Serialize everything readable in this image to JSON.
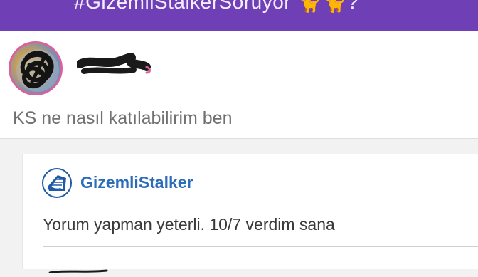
{
  "header": {
    "title": "#GizemliStalkerSoruyor 🐈🐈?",
    "background": "#6f3fb5"
  },
  "post": {
    "avatar_icon": "user-avatar-scribbled",
    "username_icon": "redacted-username",
    "text": "KS ne nasıl katılabilirim ben"
  },
  "reply": {
    "avatar_icon": "gizemlistalker-avatar",
    "username": "GizemliStalker",
    "username_color": "#2c6cb8",
    "text": "Yorum yapman yeterli. 10/7 verdim sana"
  }
}
